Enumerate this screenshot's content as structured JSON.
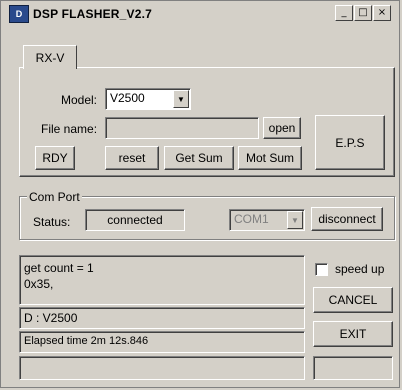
{
  "window": {
    "title": "DSP FLASHER_V2.7",
    "icon": "dsp-app-icon",
    "icon_text": "D"
  },
  "titlebar_buttons": {
    "minimize": "_",
    "maximize": "□",
    "close": "×"
  },
  "tab": {
    "label": "RX-V"
  },
  "model": {
    "label": "Model:",
    "value": "V2500"
  },
  "file": {
    "label": "File name:",
    "value": "",
    "open_label": "open"
  },
  "buttons": {
    "rdy": "RDY",
    "reset": "reset",
    "get_sum": "Get Sum",
    "mot_sum": "Mot Sum",
    "eps": "E.P.S"
  },
  "com_port": {
    "group_label": "Com Port",
    "status_label": "Status:",
    "status_value": "connected",
    "port_value": "COM1",
    "disconnect_label": "disconnect"
  },
  "log": {
    "line1": "get count = 1",
    "line2": "0x35,"
  },
  "id_field": "D : V2500",
  "elapsed_field": "Elapsed time 2m 12s.846",
  "bottom_field": "",
  "side": {
    "speed_up_label": "speed up",
    "speed_up_checked": false,
    "cancel_label": "CANCEL",
    "exit_label": "EXIT",
    "side_field": ""
  }
}
